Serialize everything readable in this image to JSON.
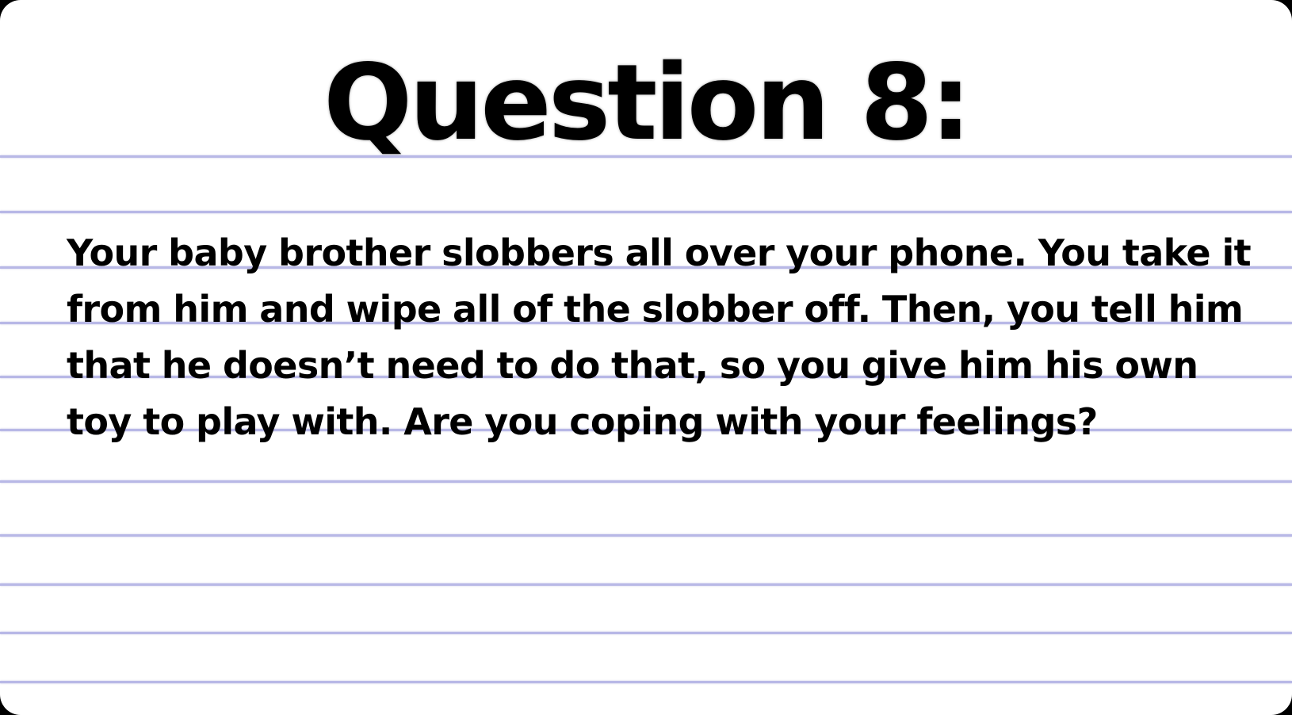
{
  "card": {
    "title": "Question 8:",
    "question_text": "Your baby brother slobbers all over your phone. You take it from him and wipe all of the slobber off. Then, you tell him that he doesn’t need to do that, so you give him his own toy to play with. Are you coping with your feelings?"
  },
  "colors": {
    "background": "#000000",
    "card": "#ffffff",
    "rule_lines": "#b8b8e6",
    "text": "#000000"
  }
}
